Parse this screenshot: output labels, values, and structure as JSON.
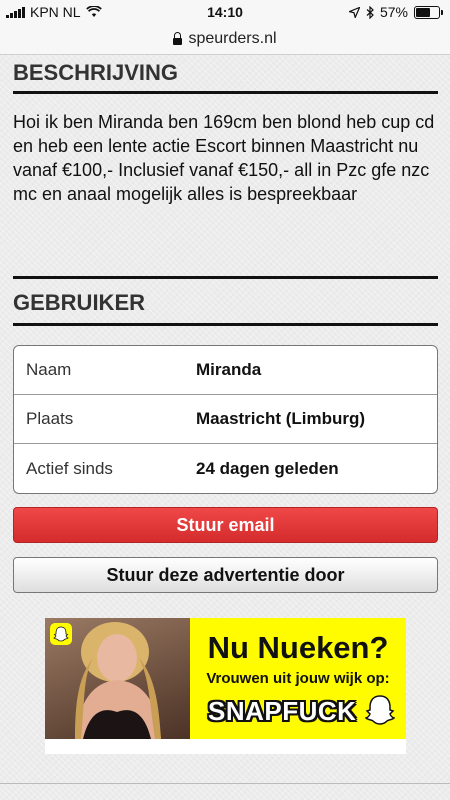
{
  "status_bar": {
    "carrier": "KPN NL",
    "time": "14:10",
    "battery": "57%",
    "battery_level": 0.57
  },
  "browser": {
    "url": "speurders.nl"
  },
  "description": {
    "title": "BESCHRIJVING",
    "text": "Hoi ik ben Miranda ben 169cm ben blond heb cup cd en heb een lente actie Escort binnen Maastricht nu vanaf €100,- Inclusief vanaf €150,- all in Pzc gfe nzc mc en anaal mogelijk alles is bespreekbaar"
  },
  "user": {
    "title": "GEBRUIKER",
    "rows": [
      {
        "label": "Naam",
        "value": "Miranda"
      },
      {
        "label": "Plaats",
        "value": "Maastricht (Limburg)"
      },
      {
        "label": "Actief sinds",
        "value": "24 dagen geleden"
      }
    ]
  },
  "actions": {
    "email": "Stuur email",
    "share": "Stuur deze advertentie door"
  },
  "ad": {
    "headline": "Nu Nueken?",
    "subline": "Vrouwen uit jouw wijk op:",
    "brand": "SNAPFUCK"
  },
  "colors": {
    "accent_red": "#e23a3a",
    "ad_yellow": "#fffc00"
  }
}
